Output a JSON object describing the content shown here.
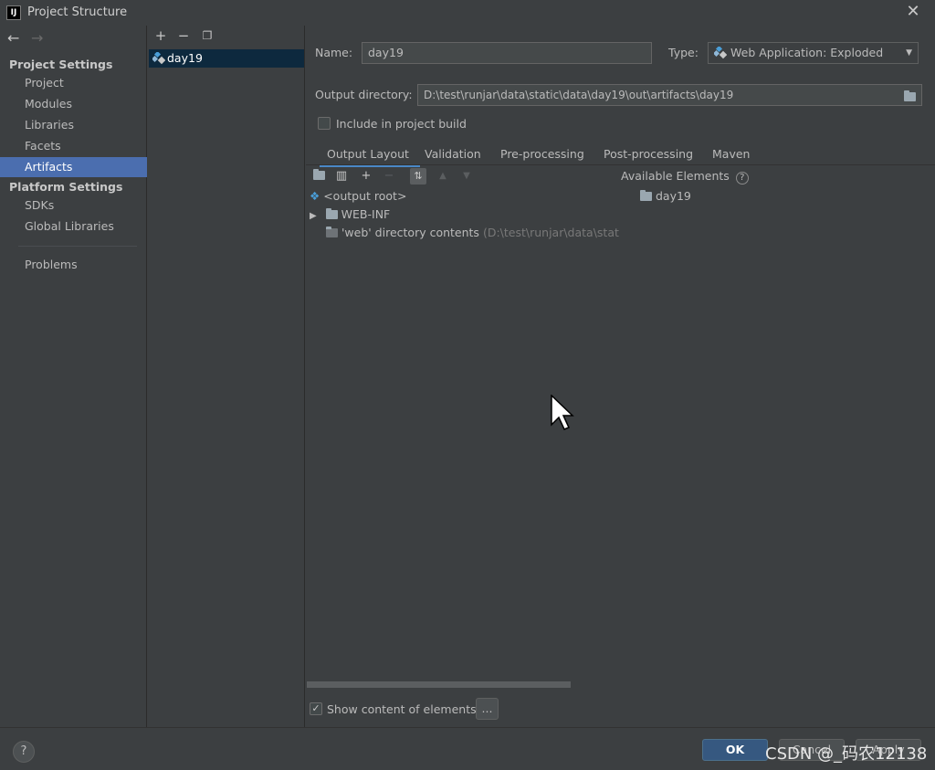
{
  "window": {
    "title": "Project Structure"
  },
  "nav": {
    "project_settings_heading": "Project Settings",
    "project_items": [
      {
        "label": "Project"
      },
      {
        "label": "Modules"
      },
      {
        "label": "Libraries"
      },
      {
        "label": "Facets"
      },
      {
        "label": "Artifacts",
        "selected": true
      }
    ],
    "platform_settings_heading": "Platform Settings",
    "platform_items": [
      {
        "label": "SDKs"
      },
      {
        "label": "Global Libraries"
      }
    ],
    "problems_label": "Problems"
  },
  "artifacts": {
    "items": [
      {
        "label": "day19",
        "selected": true
      }
    ]
  },
  "artifact_settings": {
    "name_label": "Name:",
    "name_value": "day19",
    "type_label": "Type:",
    "type_value": "Web Application: Exploded",
    "output_dir_label": "Output directory:",
    "output_dir_value": "D:\\test\\runjar\\data\\static\\data\\day19\\out\\artifacts\\day19",
    "include_in_build_label": "Include in project build",
    "include_in_build_checked": false
  },
  "tabs": [
    {
      "label": "Output Layout",
      "selected": true
    },
    {
      "label": "Validation"
    },
    {
      "label": "Pre-processing"
    },
    {
      "label": "Post-processing"
    },
    {
      "label": "Maven"
    }
  ],
  "output_layout": {
    "available_elements_label": "Available Elements",
    "tree": [
      {
        "label": "<output root>"
      },
      {
        "label": "WEB-INF"
      },
      {
        "label": "'web' directory contents",
        "detail": "(D:\\test\\runjar\\data\\static\\da"
      }
    ],
    "available": [
      {
        "label": "day19"
      }
    ],
    "show_content_label": "Show content of elements",
    "show_content_checked": true,
    "more_button_label": "..."
  },
  "footer": {
    "help_label": "?",
    "ok_label": "OK",
    "cancel_label": "Cancel",
    "apply_label": "Apply",
    "watermark": "CSDN @_码农12138"
  },
  "colors": {
    "background": "#3c3f41",
    "selection": "#4b6eaf",
    "list_selection": "#0d293e",
    "accent_tab": "#4a88c7",
    "primary_button": "#365880"
  },
  "icons": [
    "back-arrow-icon",
    "forward-arrow-icon",
    "add-icon",
    "remove-icon",
    "copy-icon",
    "artifact-icon",
    "folder-icon",
    "help-icon",
    "close-icon"
  ]
}
